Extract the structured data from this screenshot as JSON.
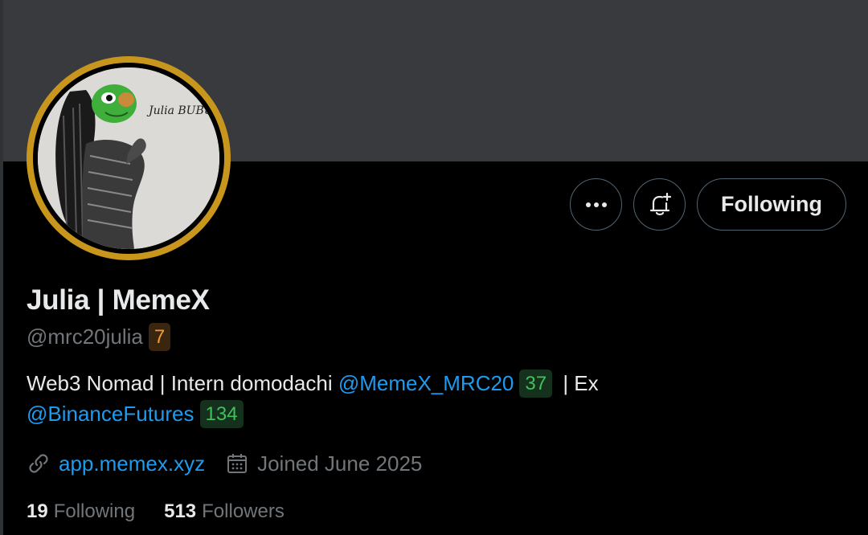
{
  "profile": {
    "display_name": "Julia | MemeX",
    "handle": "@mrc20julia",
    "handle_badge": "7",
    "avatar_signature": "Julia BUBU",
    "bio": {
      "line1_text": "Web3 Nomad | Intern domodachi ",
      "mention1": "@MemeX_MRC20",
      "mention1_badge": "37",
      "line1_suffix": " | Ex",
      "mention2": "@BinanceFutures",
      "mention2_badge": "134"
    },
    "website": "app.memex.xyz",
    "joined": "Joined June 2025",
    "following_count": "19",
    "following_label": "Following",
    "followers_count": "513",
    "followers_label": "Followers"
  },
  "actions": {
    "more_icon": "more-horizontal-icon",
    "notify_icon": "bell-plus-icon",
    "follow_button_label": "Following"
  },
  "colors": {
    "background": "#000000",
    "banner": "#393a3e",
    "avatar_ring": "#c9961d",
    "link": "#1d9bf0",
    "muted": "#71767b",
    "badge_orange": "#f29b2e",
    "badge_green": "#3ec25a"
  }
}
